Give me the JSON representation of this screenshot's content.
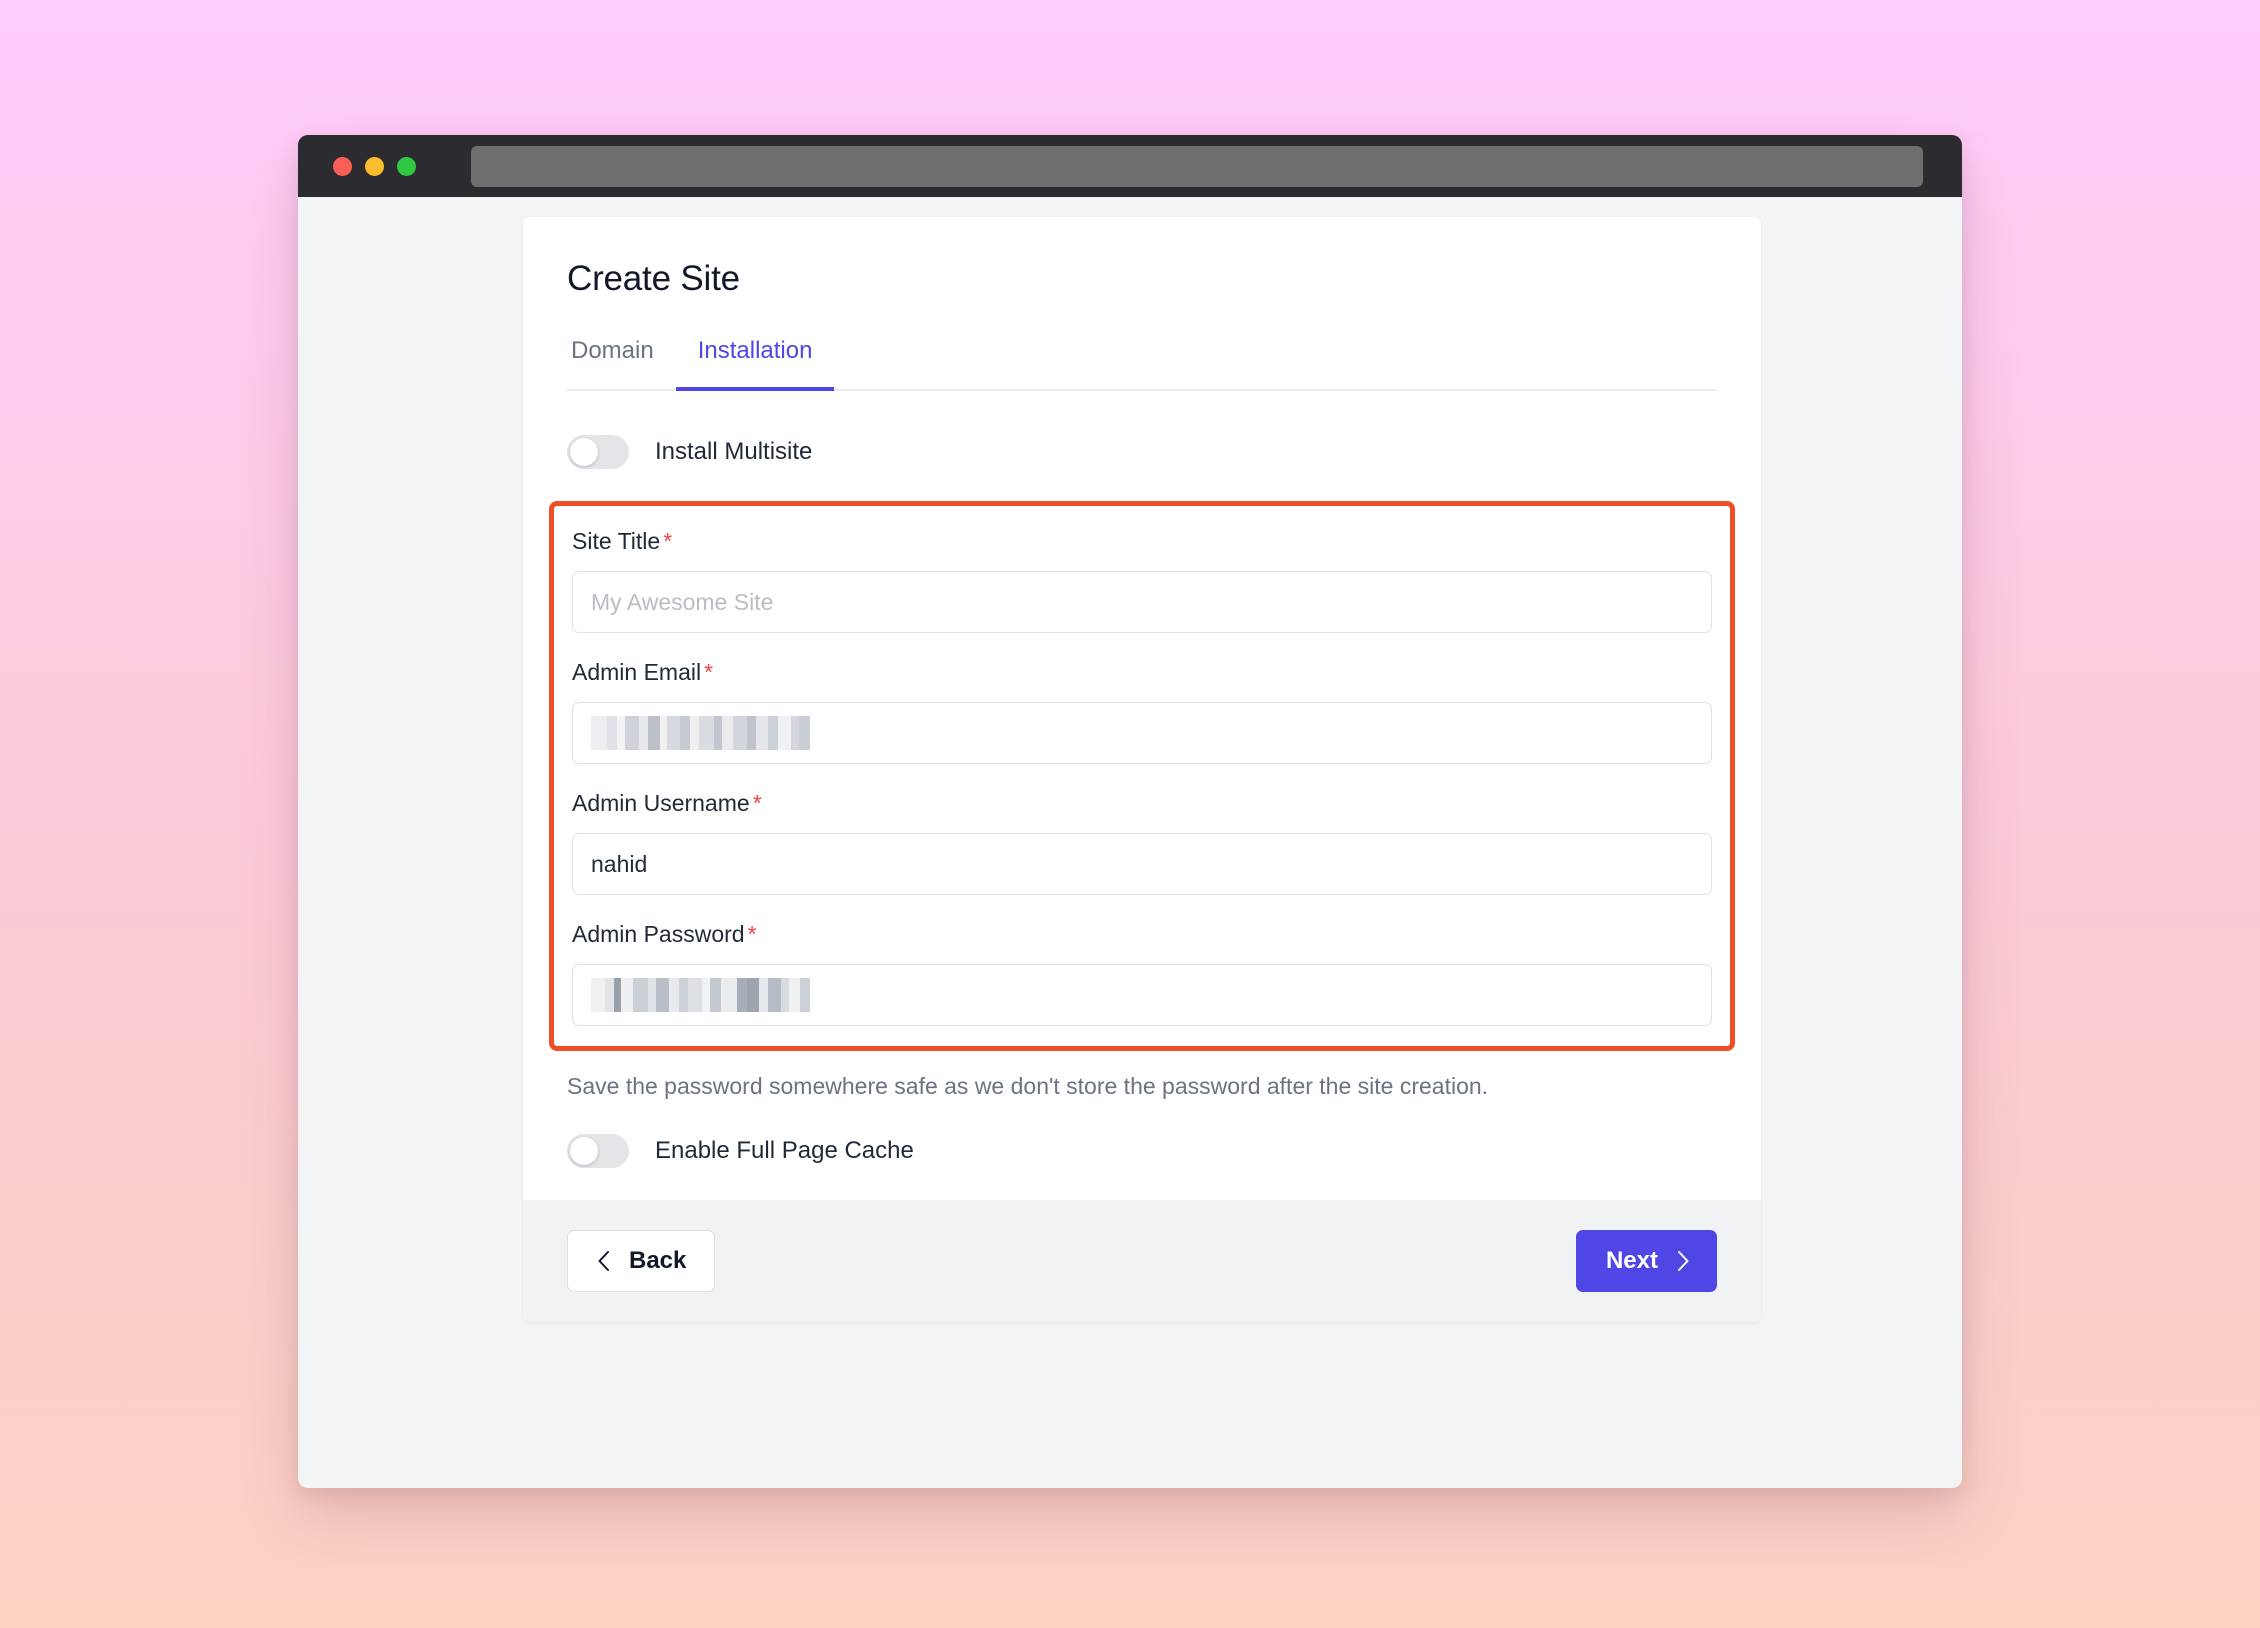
{
  "browser": {
    "traffic_lights": [
      "close",
      "minimize",
      "maximize"
    ],
    "address_value": "",
    "colors": {
      "chrome": "#2c2c30",
      "address_bar": "#6e6e6e"
    }
  },
  "card": {
    "title": "Create Site",
    "tabs": [
      {
        "label": "Domain",
        "active": false
      },
      {
        "label": "Installation",
        "active": true
      }
    ],
    "toggles": {
      "multisite": {
        "label": "Install Multisite",
        "state": "off"
      },
      "full_page_cache": {
        "label": "Enable Full Page Cache",
        "state": "off"
      }
    },
    "fields": [
      {
        "label": "Site Title",
        "required_marker": "*",
        "placeholder": "My Awesome Site",
        "value": "",
        "redacted": false
      },
      {
        "label": "Admin Email",
        "required_marker": "*",
        "placeholder": "",
        "value": "",
        "redacted": true
      },
      {
        "label": "Admin Username",
        "required_marker": "*",
        "placeholder": "",
        "value": "nahid",
        "redacted": false
      },
      {
        "label": "Admin Password",
        "required_marker": "*",
        "placeholder": "",
        "value": "",
        "redacted": true
      }
    ],
    "hint": "Save the password somewhere safe as we don't store the password after the site creation.",
    "footer": {
      "back_label": "Back",
      "next_label": "Next",
      "back_icon": "chevron-left-icon",
      "next_icon": "chevron-right-icon"
    }
  },
  "annotation": {
    "highlight_color": "#f04e23",
    "target": "installation-credentials-fields"
  },
  "colors": {
    "accent": "#4f46e5",
    "required_asterisk": "#ef4444",
    "page_bg_top": "#ffccff",
    "page_bg_bottom": "#fcd3c3",
    "footer_bg": "#f1f2f4"
  }
}
